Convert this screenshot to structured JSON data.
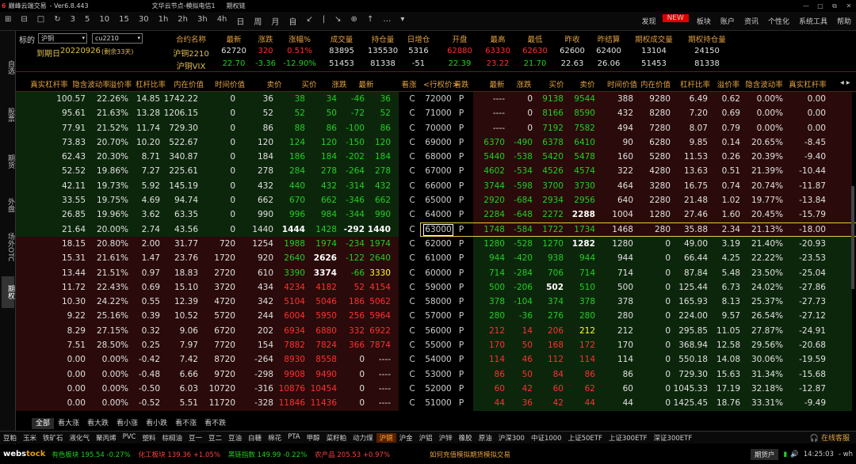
{
  "title": {
    "logo": "6",
    "app": "巅峰云端交易",
    "version": "- Ver6.8.443",
    "server": "文华云节点-模拟电信1",
    "window": "期权链",
    "win_min": "—",
    "win_max": "□",
    "win_restore": "⧉",
    "win_close": "✕"
  },
  "toolbar": {
    "items": [
      "⊞",
      "⊟",
      "□",
      "↻",
      "3",
      "5",
      "10",
      "15",
      "30",
      "1h",
      "2h",
      "3h",
      "4h",
      "日",
      "周",
      "月",
      "自",
      "↙",
      "|",
      "↘",
      "⊕",
      "↑",
      "…",
      "▾"
    ],
    "right": [
      "发现",
      "板块",
      "账户",
      "资讯",
      "个性化",
      "系统工具",
      "帮助"
    ],
    "new_badge": "NEW"
  },
  "sidebar": [
    "自选",
    "股票",
    "期货",
    "外盘",
    "场外OTC",
    "期权"
  ],
  "info": {
    "underlying_label": "标的",
    "underlying_value": "沪铜",
    "contract_value": "cu2210",
    "expiry_label": "到期日",
    "expiry_value": "20220926",
    "remaining": "(剩余33天)",
    "headers": [
      "合约名称",
      "最新",
      "涨跌",
      "涨幅%",
      "成交量",
      "持仓量",
      "日增仓",
      "开盘",
      "最高",
      "最低",
      "昨收",
      "昨结算",
      "期权成交量",
      "期权持仓量"
    ],
    "row1": [
      "沪铜2210",
      "62720",
      "320",
      "0.51%",
      "83895",
      "135530",
      "5316",
      "62880",
      "63330",
      "62630",
      "62600",
      "62400",
      "13104",
      "24150"
    ],
    "row2": [
      "沪铜VIX",
      "22.70",
      "-3.36",
      "-12.90%",
      "51453",
      "81338",
      "-51",
      "22.39",
      "23.22",
      "21.70",
      "22.63",
      "26.06",
      "51453",
      "81338"
    ]
  },
  "table_headers": {
    "left": [
      "真实杠杆率",
      "隐含波动率",
      "溢价率",
      "杠杆比率",
      "内在价值",
      "时间价值",
      "卖价",
      "买价",
      "涨跌",
      "最新"
    ],
    "middle": [
      "看涨",
      "<行权价>",
      "看跌"
    ],
    "right": [
      "最新",
      "涨跌",
      "买价",
      "卖价",
      "时间价值",
      "内在价值",
      "杠杆比率",
      "溢价率",
      "隐含波动率",
      "真实杠杆率"
    ],
    "nav": "◂ ▸"
  },
  "rows": [
    {
      "l": [
        "100.57",
        "22.26%",
        "14.85",
        "1742.22",
        "0",
        "36",
        "38",
        "34",
        "-46",
        "36"
      ],
      "s": "72000",
      "r": [
        "----",
        "0",
        "9138",
        "9544",
        "388",
        "9280",
        "6.49",
        "0.62",
        "0.00%",
        "0.00"
      ]
    },
    {
      "l": [
        "95.61",
        "21.63%",
        "13.28",
        "1206.15",
        "0",
        "52",
        "52",
        "50",
        "-72",
        "52"
      ],
      "s": "71000",
      "r": [
        "----",
        "0",
        "8166",
        "8590",
        "432",
        "8280",
        "7.20",
        "0.69",
        "0.00%",
        "0.00"
      ]
    },
    {
      "l": [
        "77.91",
        "21.52%",
        "11.74",
        "729.30",
        "0",
        "86",
        "88",
        "86",
        "-100",
        "86"
      ],
      "s": "70000",
      "r": [
        "----",
        "0",
        "7192",
        "7582",
        "494",
        "7280",
        "8.07",
        "0.79",
        "0.00%",
        "0.00"
      ]
    },
    {
      "l": [
        "73.83",
        "20.70%",
        "10.20",
        "522.67",
        "0",
        "120",
        "124",
        "120",
        "-150",
        "120"
      ],
      "s": "69000",
      "r": [
        "6370",
        "-490",
        "6378",
        "6410",
        "90",
        "6280",
        "9.85",
        "0.14",
        "20.65%",
        "-8.45"
      ]
    },
    {
      "l": [
        "62.43",
        "20.30%",
        "8.71",
        "340.87",
        "0",
        "184",
        "186",
        "184",
        "-202",
        "184"
      ],
      "s": "68000",
      "r": [
        "5440",
        "-538",
        "5420",
        "5478",
        "160",
        "5280",
        "11.53",
        "0.26",
        "20.39%",
        "-9.40"
      ]
    },
    {
      "l": [
        "52.52",
        "19.86%",
        "7.27",
        "225.61",
        "0",
        "278",
        "284",
        "278",
        "-264",
        "278"
      ],
      "s": "67000",
      "r": [
        "4602",
        "-534",
        "4526",
        "4574",
        "322",
        "4280",
        "13.63",
        "0.51",
        "21.39%",
        "-10.44"
      ]
    },
    {
      "l": [
        "42.11",
        "19.73%",
        "5.92",
        "145.19",
        "0",
        "432",
        "440",
        "432",
        "-314",
        "432"
      ],
      "s": "66000",
      "r": [
        "3744",
        "-598",
        "3700",
        "3730",
        "464",
        "3280",
        "16.75",
        "0.74",
        "20.74%",
        "-11.87"
      ]
    },
    {
      "l": [
        "33.55",
        "19.75%",
        "4.69",
        "94.74",
        "0",
        "662",
        "670",
        "662",
        "-346",
        "662"
      ],
      "s": "65000",
      "r": [
        "2920",
        "-684",
        "2934",
        "2956",
        "640",
        "2280",
        "21.48",
        "1.02",
        "19.77%",
        "-13.84"
      ]
    },
    {
      "l": [
        "26.85",
        "19.96%",
        "3.62",
        "63.35",
        "0",
        "990",
        "996",
        "984",
        "-344",
        "990"
      ],
      "s": "64000",
      "r": [
        "2284",
        "-648",
        "2272",
        "2288",
        "1004",
        "1280",
        "27.46",
        "1.60",
        "20.45%",
        "-15.79"
      ]
    },
    {
      "l": [
        "21.64",
        "20.00%",
        "2.74",
        "43.56",
        "0",
        "1440",
        "1444",
        "1428",
        "-292",
        "1440"
      ],
      "s": "63000",
      "r": [
        "1748",
        "-584",
        "1722",
        "1734",
        "1468",
        "280",
        "35.88",
        "2.34",
        "21.13%",
        "-18.00"
      ]
    },
    {
      "l": [
        "18.15",
        "20.80%",
        "2.00",
        "31.77",
        "720",
        "1254",
        "1988",
        "1974",
        "-234",
        "1974"
      ],
      "s": "62000",
      "r": [
        "1280",
        "-528",
        "1270",
        "1282",
        "1280",
        "0",
        "49.00",
        "3.19",
        "21.40%",
        "-20.93"
      ]
    },
    {
      "l": [
        "15.31",
        "21.61%",
        "1.47",
        "23.76",
        "1720",
        "920",
        "2640",
        "2626",
        "-122",
        "2640"
      ],
      "s": "61000",
      "r": [
        "944",
        "-420",
        "938",
        "944",
        "944",
        "0",
        "66.44",
        "4.25",
        "22.22%",
        "-23.53"
      ]
    },
    {
      "l": [
        "13.44",
        "21.51%",
        "0.97",
        "18.83",
        "2720",
        "610",
        "3390",
        "3374",
        "-66",
        "3330"
      ],
      "s": "60000",
      "r": [
        "714",
        "-284",
        "706",
        "714",
        "714",
        "0",
        "87.84",
        "5.48",
        "23.50%",
        "-25.04"
      ]
    },
    {
      "l": [
        "11.72",
        "22.43%",
        "0.69",
        "15.10",
        "3720",
        "434",
        "4234",
        "4182",
        "52",
        "4154"
      ],
      "s": "59000",
      "r": [
        "500",
        "-206",
        "502",
        "510",
        "500",
        "0",
        "125.44",
        "6.73",
        "24.02%",
        "-27.86"
      ]
    },
    {
      "l": [
        "10.30",
        "24.22%",
        "0.55",
        "12.39",
        "4720",
        "342",
        "5104",
        "5046",
        "186",
        "5062"
      ],
      "s": "58000",
      "r": [
        "378",
        "-104",
        "374",
        "378",
        "378",
        "0",
        "165.93",
        "8.13",
        "25.37%",
        "-27.73"
      ]
    },
    {
      "l": [
        "9.22",
        "25.16%",
        "0.39",
        "10.52",
        "5720",
        "244",
        "6004",
        "5950",
        "256",
        "5964"
      ],
      "s": "57000",
      "r": [
        "280",
        "-36",
        "276",
        "280",
        "280",
        "0",
        "224.00",
        "9.57",
        "26.54%",
        "-27.12"
      ]
    },
    {
      "l": [
        "8.29",
        "27.15%",
        "0.32",
        "9.06",
        "6720",
        "202",
        "6934",
        "6880",
        "332",
        "6922"
      ],
      "s": "56000",
      "r": [
        "212",
        "14",
        "206",
        "212",
        "212",
        "0",
        "295.85",
        "11.05",
        "27.87%",
        "-24.91"
      ]
    },
    {
      "l": [
        "7.51",
        "28.50%",
        "0.25",
        "7.97",
        "7720",
        "154",
        "7882",
        "7824",
        "366",
        "7874"
      ],
      "s": "55000",
      "r": [
        "170",
        "50",
        "168",
        "172",
        "170",
        "0",
        "368.94",
        "12.58",
        "29.56%",
        "-20.68"
      ]
    },
    {
      "l": [
        "0.00",
        "0.00%",
        "-0.42",
        "7.42",
        "8720",
        "-264",
        "8930",
        "8558",
        "0",
        "----"
      ],
      "s": "54000",
      "r": [
        "114",
        "46",
        "112",
        "114",
        "114",
        "0",
        "550.18",
        "14.08",
        "30.06%",
        "-19.59"
      ]
    },
    {
      "l": [
        "0.00",
        "0.00%",
        "-0.48",
        "6.66",
        "9720",
        "-298",
        "9908",
        "9490",
        "0",
        "----"
      ],
      "s": "53000",
      "r": [
        "86",
        "50",
        "84",
        "86",
        "86",
        "0",
        "729.30",
        "15.63",
        "31.34%",
        "-15.68"
      ]
    },
    {
      "l": [
        "0.00",
        "0.00%",
        "-0.50",
        "6.03",
        "10720",
        "-316",
        "10876",
        "10454",
        "0",
        "----"
      ],
      "s": "52000",
      "r": [
        "60",
        "42",
        "60",
        "62",
        "60",
        "0",
        "1045.33",
        "17.19",
        "32.18%",
        "-12.87"
      ]
    },
    {
      "l": [
        "0.00",
        "0.00%",
        "-0.52",
        "5.51",
        "11720",
        "-328",
        "11846",
        "11436",
        "0",
        "----"
      ],
      "s": "51000",
      "r": [
        "44",
        "36",
        "42",
        "44",
        "44",
        "0",
        "1425.45",
        "18.76",
        "33.31%",
        "-9.49"
      ]
    }
  ],
  "call_label": "C",
  "put_label": "P",
  "filters": [
    "全部",
    "看大涨",
    "看大跌",
    "看小涨",
    "看小跌",
    "看不涨",
    "看不跌"
  ],
  "categories": [
    "豆粕",
    "玉米",
    "铁矿石",
    "液化气",
    "聚丙烯",
    "PVC",
    "塑料",
    "棕榈油",
    "豆一",
    "豆二",
    "豆油",
    "白糖",
    "棉花",
    "PTA",
    "甲醇",
    "菜籽粕",
    "动力煤",
    "沪铜",
    "沪金",
    "沪铝",
    "沪锌",
    "橡胶",
    "原油",
    "沪深300",
    "中证1000",
    "上证50ETF",
    "上证300ETF",
    "深证300ETF"
  ],
  "service": "在线客服",
  "status": {
    "logo_a": "webs",
    "logo_b": "tock",
    "markets": [
      {
        "name": "有色板块",
        "value": "195.54",
        "change": "-0.27%",
        "cls": "n"
      },
      {
        "name": "化工板块",
        "value": "139.36",
        "change": "+1.05%",
        "cls": "p"
      },
      {
        "name": "黑链指数",
        "value": "149.99",
        "change": "-0.22%",
        "cls": "n"
      },
      {
        "name": "农产品",
        "value": "205.53",
        "change": "+0.97%",
        "cls": "p"
      }
    ],
    "notice": "如何充值模拟期货模拟交易",
    "account": "期货户",
    "time": "14:25:03",
    "user": "- wh"
  }
}
